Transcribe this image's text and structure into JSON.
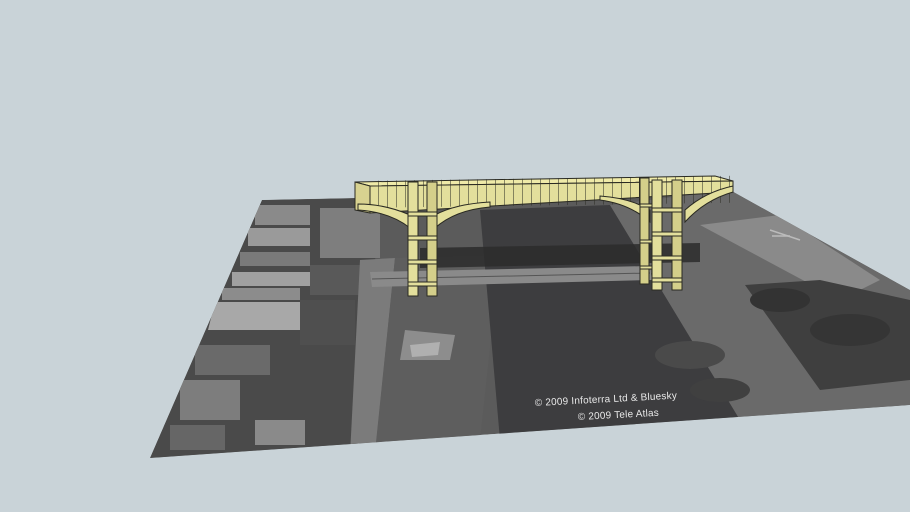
{
  "scene": {
    "background_color": "#c9d3d8",
    "ground_color": "#5a5a5a",
    "river_color": "#3e3e40",
    "bridge_color": "#e3df9c",
    "bridge_outline_color": "#2a2a22"
  },
  "attribution": {
    "line1": "© 2009 Infoterra Ltd & Bluesky",
    "line2": "© 2009 Tele Atlas"
  }
}
